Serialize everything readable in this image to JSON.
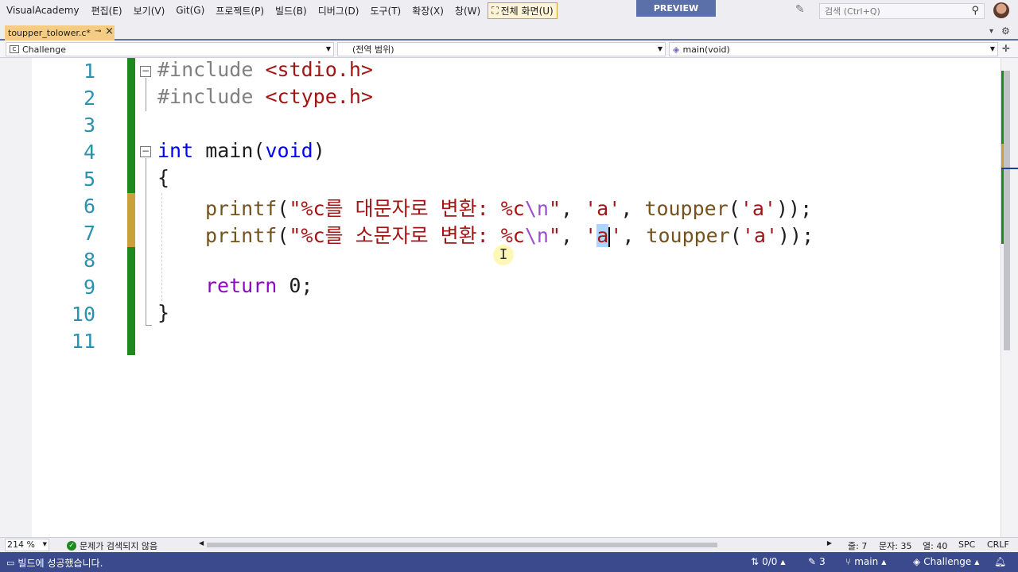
{
  "menubar": {
    "app_title": "VisualAcademy",
    "items": [
      "편집(E)",
      "보기(V)",
      "Git(G)",
      "프로젝트(P)",
      "빌드(B)",
      "디버그(D)",
      "도구(T)",
      "확장(X)",
      "창(W)"
    ],
    "fullscreen_label": "전체 화면(U)",
    "preview_label": "PREVIEW",
    "search_placeholder": "검색 (Ctrl+Q)"
  },
  "tabs": {
    "active_file": "toupper_tolower.c*",
    "pin_glyph": "⊸",
    "close_glyph": "×"
  },
  "navbar": {
    "project": "Challenge",
    "scope": "(전역 범위)",
    "member": "main(void)"
  },
  "editor": {
    "line_numbers": [
      "1",
      "2",
      "3",
      "4",
      "5",
      "6",
      "7",
      "8",
      "9",
      "10",
      "11"
    ],
    "lines": {
      "l1_a": "#include ",
      "l1_b": "<stdio.h>",
      "l2_a": "#include ",
      "l2_b": "<ctype.h>",
      "l4_a": "int",
      "l4_b": " main(",
      "l4_c": "void",
      "l4_d": ")",
      "l5": "{",
      "l6_fn": "printf",
      "l6_p1": "(",
      "l6_s1": "\"%c를 대문자로 변환: %c",
      "l6_esc": "\\n",
      "l6_s2": "\"",
      "l6_c1": ", ",
      "l6_ch1": "'a'",
      "l6_c2": ", ",
      "l6_fn2": "toupper",
      "l6_p2": "(",
      "l6_ch2": "'a'",
      "l6_end": "));",
      "l7_fn": "printf",
      "l7_p1": "(",
      "l7_s1": "\"%c를 소문자로 변환: %c",
      "l7_esc": "\\n",
      "l7_s2": "\"",
      "l7_c1": ", ",
      "l7_q1": "'",
      "l7_sel": "a",
      "l7_q2": "'",
      "l7_c2": ", ",
      "l7_fn2": "toupper",
      "l7_p2": "(",
      "l7_ch2": "'a'",
      "l7_end": "));",
      "l9_a": "return",
      "l9_b": " 0;",
      "l10": "}"
    }
  },
  "editor_status": {
    "zoom": "214 %",
    "issues": "문제가 검색되지 않음",
    "line": "줄: 7",
    "char": "문자: 35",
    "col": "열: 40",
    "spc": "SPC",
    "crlf": "CRLF"
  },
  "statusbar": {
    "build_message": "빌드에 성공했습니다.",
    "updown": "0/0",
    "edits": "3",
    "branch": "main",
    "repo": "Challenge"
  },
  "colors": {
    "accent": "#3a4a8c",
    "tab_active": "#f5cc84",
    "change_saved": "#1e8a1e",
    "change_unsaved": "#c9a13b"
  }
}
